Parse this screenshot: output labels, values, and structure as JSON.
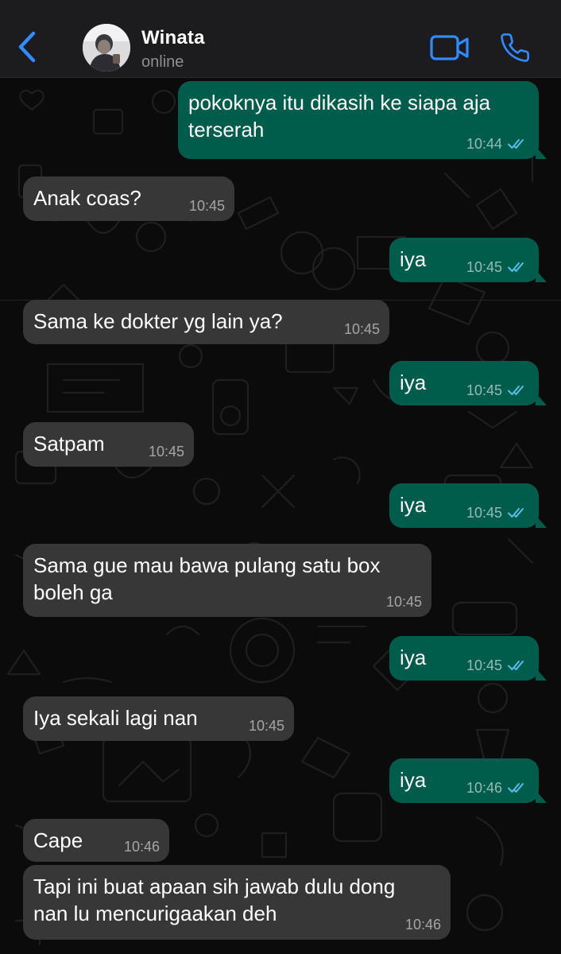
{
  "header": {
    "contact_name": "Winata",
    "status": "online",
    "back_icon": "chevron-left-icon",
    "video_icon": "video-camera-icon",
    "call_icon": "phone-icon"
  },
  "colors": {
    "incoming_bubble": "#373737",
    "outgoing_bubble": "#005c4b",
    "read_ticks": "#53bdeb",
    "header_icons": "#2f8bff"
  },
  "messages": [
    {
      "direction": "out",
      "text": "pokoknya itu dikasih ke siapa aja\nterserah",
      "time": "10:44",
      "status": "read"
    },
    {
      "direction": "in",
      "text": "Anak coas?",
      "time": "10:45"
    },
    {
      "direction": "out",
      "text": "iya",
      "time": "10:45",
      "status": "read"
    },
    {
      "direction": "in",
      "text": "Sama ke dokter yg lain ya?",
      "time": "10:45"
    },
    {
      "direction": "out",
      "text": "iya",
      "time": "10:45",
      "status": "read"
    },
    {
      "direction": "in",
      "text": "Satpam",
      "time": "10:45"
    },
    {
      "direction": "out",
      "text": "iya",
      "time": "10:45",
      "status": "read"
    },
    {
      "direction": "in",
      "text": "Sama gue mau bawa pulang satu box\nboleh ga",
      "time": "10:45"
    },
    {
      "direction": "out",
      "text": "iya",
      "time": "10:45",
      "status": "read"
    },
    {
      "direction": "in",
      "text": "Iya sekali lagi nan",
      "time": "10:45"
    },
    {
      "direction": "out",
      "text": "iya",
      "time": "10:46",
      "status": "read"
    },
    {
      "direction": "in",
      "text": "Cape",
      "time": "10:46"
    },
    {
      "direction": "in",
      "text": "Tapi ini buat apaan sih jawab dulu dong\nnan lu mencurigaakan deh",
      "time": "10:46"
    }
  ]
}
